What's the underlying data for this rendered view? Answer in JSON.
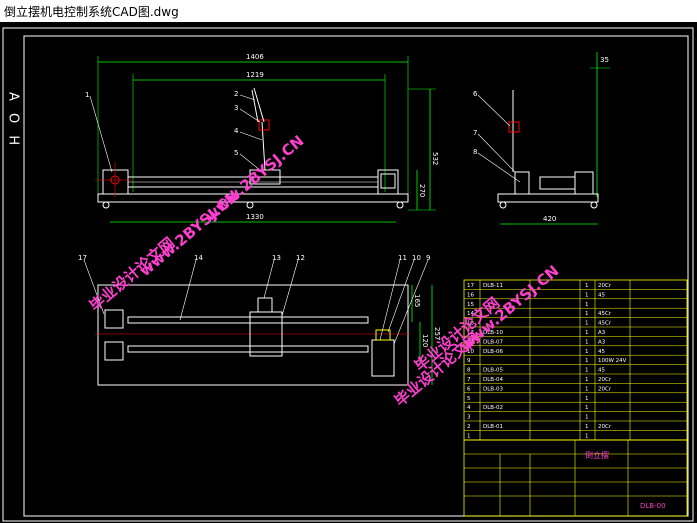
{
  "window": {
    "title": "倒立摆机电控制系统CAD图.dwg"
  },
  "colors": {
    "background": "#000000",
    "border": "#ffffff",
    "dimension": "#00ff00",
    "watermark": "#ff3fd0",
    "annotation": "#ffffff",
    "part": "#ff0000",
    "tableline": "#ffff00"
  },
  "frame_side_label": "A O H",
  "front_view": {
    "dims": [
      "1406",
      "1219",
      "1330",
      "532",
      "270"
    ],
    "balloons": [
      "1",
      "2",
      "3",
      "4",
      "5"
    ]
  },
  "side_view": {
    "dims": [
      "35",
      "420"
    ],
    "balloons": [
      "6",
      "7",
      "8"
    ]
  },
  "top_view": {
    "dims": [
      "165",
      "120",
      "257"
    ],
    "balloons": [
      "17",
      "14",
      "13",
      "12",
      "11",
      "10",
      "9"
    ]
  },
  "watermarks": [
    {
      "text": "毕业设计论文网",
      "kind": "cn"
    },
    {
      "text": "www.2BYSJ.CN",
      "kind": "url"
    },
    {
      "text": "www.2BYSJ.CN",
      "kind": "url"
    },
    {
      "text": "毕业设计论文网",
      "kind": "cn"
    },
    {
      "text": "www.2BYSJ.CN",
      "kind": "url"
    },
    {
      "text": "毕业设计论文网",
      "kind": "cn"
    }
  ],
  "bom": {
    "rows": [
      {
        "no": "17",
        "code": "DLB-11",
        "name": "",
        "qty": "1",
        "mat": "20Cr"
      },
      {
        "no": "16",
        "code": "",
        "name": "",
        "qty": "1",
        "mat": "45"
      },
      {
        "no": "15",
        "code": "",
        "name": "",
        "qty": "1",
        "mat": ""
      },
      {
        "no": "14",
        "code": "",
        "name": "",
        "qty": "1",
        "mat": "45Cr"
      },
      {
        "no": "13",
        "code": "",
        "name": "",
        "qty": "1",
        "mat": "45Cr"
      },
      {
        "no": "12",
        "code": "DLB-10",
        "name": "",
        "qty": "1",
        "mat": "A3"
      },
      {
        "no": "11",
        "code": "DLB-07",
        "name": "",
        "qty": "1",
        "mat": "A3"
      },
      {
        "no": "10",
        "code": "DLB-06",
        "name": "",
        "qty": "1",
        "mat": "45"
      },
      {
        "no": "9",
        "code": "",
        "name": "",
        "qty": "1",
        "mat": "100W 24V"
      },
      {
        "no": "8",
        "code": "DLB-05",
        "name": "",
        "qty": "1",
        "mat": "45"
      },
      {
        "no": "7",
        "code": "DLB-04",
        "name": "",
        "qty": "1",
        "mat": "20Cr"
      },
      {
        "no": "6",
        "code": "DLB-03",
        "name": "",
        "qty": "1",
        "mat": "20Cr"
      },
      {
        "no": "5",
        "code": "",
        "name": "",
        "qty": "1",
        "mat": ""
      },
      {
        "no": "4",
        "code": "DLB-02",
        "name": "",
        "qty": "1",
        "mat": ""
      },
      {
        "no": "3",
        "code": "",
        "name": "",
        "qty": "1",
        "mat": ""
      },
      {
        "no": "2",
        "code": "DLB-01",
        "name": "",
        "qty": "1",
        "mat": "20Cr"
      },
      {
        "no": "1",
        "code": "",
        "name": "",
        "qty": "1",
        "mat": ""
      }
    ],
    "title_block": {
      "drawing_name": "倒立摆",
      "drawing_no": "DLB-00"
    }
  }
}
